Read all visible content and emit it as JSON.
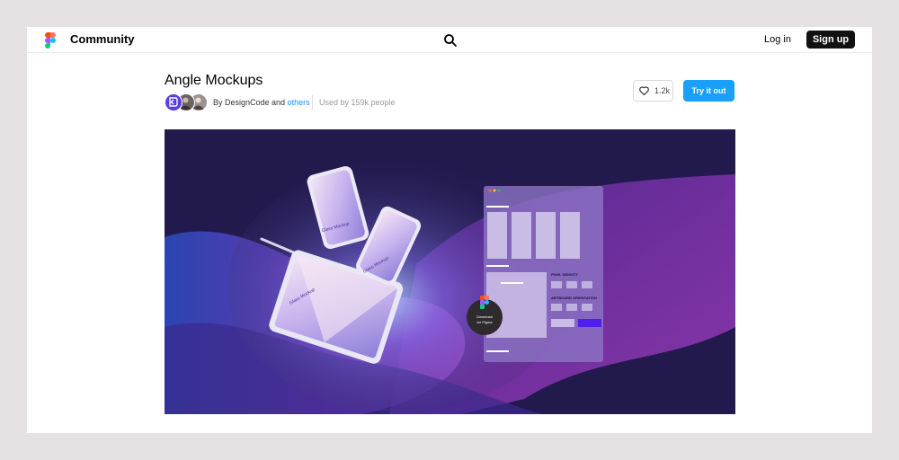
{
  "navbar": {
    "brand_label": "Community",
    "logo_icon": "figma-logo",
    "search_icon": "search-icon",
    "login_label": "Log in",
    "signup_label": "Sign up"
  },
  "file": {
    "title": "Angle Mockups",
    "byline_prefix": "By DesignCode and",
    "byline_link": "others",
    "used_by": "Used by 159k people",
    "likes": "1.2k",
    "like_icon": "heart-icon",
    "try_label": "Try it out"
  },
  "hero": {
    "mockup_label": "Glass Mockup",
    "pixel_density_label": "PIXEL DENSITY",
    "artboard_orientation_label": "ARTBOARD ORIENTATION",
    "badge_line1": "Download",
    "badge_line2": "for Figma"
  },
  "colors": {
    "page_bg": "#e6e2e3",
    "accent": "#18a0fb",
    "link": "#1a8cff",
    "hero_bg": "#221a4d",
    "signup_bg": "#111111"
  }
}
